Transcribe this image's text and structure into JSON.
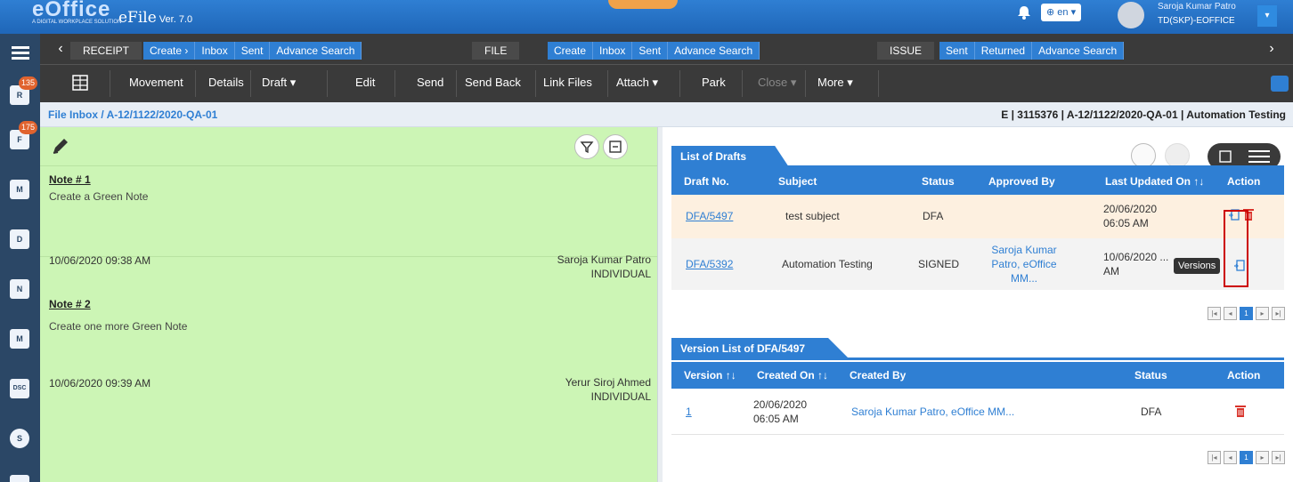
{
  "header": {
    "logo_text": "eOffice",
    "logo_tagline": "A DIGITAL WORKPLACE SOLUTION",
    "app_name": "eFile",
    "version": "Ver. 7.0",
    "language": "en",
    "user_name": "Saroja Kumar Patro",
    "user_org": "TD(SKP)-EOFFICE"
  },
  "sidebar": {
    "items": [
      {
        "name": "receipt",
        "glyph": "R",
        "badge": "135"
      },
      {
        "name": "file",
        "glyph": "F",
        "badge": "175"
      },
      {
        "name": "mail",
        "glyph": "M",
        "badge": ""
      },
      {
        "name": "dashboard",
        "glyph": "D",
        "badge": ""
      },
      {
        "name": "notification",
        "glyph": "N",
        "badge": ""
      },
      {
        "name": "movement",
        "glyph": "M",
        "badge": ""
      },
      {
        "name": "dsc",
        "glyph": "DSC",
        "badge": ""
      },
      {
        "name": "settings",
        "glyph": "S",
        "badge": ""
      },
      {
        "name": "more",
        "glyph": "",
        "badge": ""
      }
    ]
  },
  "nav": {
    "receipt": {
      "label": "RECEIPT",
      "tabs": [
        "Create ›",
        "Inbox",
        "Sent",
        "Advance Search"
      ]
    },
    "file": {
      "label": "FILE",
      "tabs": [
        "Create",
        "Inbox",
        "Sent",
        "Advance Search"
      ]
    },
    "issue": {
      "label": "ISSUE",
      "tabs": [
        "Sent",
        "Returned",
        "Advance Search"
      ]
    }
  },
  "toolbar": {
    "buttons": [
      "Movement",
      "Details",
      "Draft ▾",
      "Edit",
      "Send",
      "Send Back",
      "Link Files",
      "Attach ▾",
      "Park",
      "Close ▾",
      "More ▾"
    ]
  },
  "breadcrumb": {
    "root": "File Inbox",
    "sep": "/",
    "current": "A-12/1122/2020-QA-01",
    "info": "E | 3115376 | A-12/1122/2020-QA-01 | Automation Testing"
  },
  "notes": [
    {
      "title": "Note # 1",
      "body": "Create a Green Note",
      "date": "10/06/2020 09:38 AM",
      "author": "Saroja Kumar Patro",
      "role": "INDIVIDUAL"
    },
    {
      "title": "Note # 2",
      "body": "Create one more Green Note",
      "date": "10/06/2020 09:39 AM",
      "author": "Yerur Siroj Ahmed",
      "role": "INDIVIDUAL"
    }
  ],
  "drafts": {
    "title": "List of Drafts",
    "headers": [
      "Draft No.",
      "Subject",
      "Status",
      "Approved By",
      "Last Updated On ↑↓",
      "Action"
    ],
    "rows": [
      {
        "no": "DFA/5497",
        "subject": "test subject",
        "status": "DFA",
        "approved_by": "",
        "updated": "20/06/2020 06:05 AM"
      },
      {
        "no": "DFA/5392",
        "subject": "Automation Testing",
        "status": "SIGNED",
        "approved_by": "Saroja Kumar Patro, eOffice MM...",
        "updated": "10/06/2020 ... AM"
      }
    ],
    "tooltip": "Versions",
    "page": "1"
  },
  "versions": {
    "title": "Version List of DFA/5497",
    "headers": [
      "Version ↑↓",
      "Created On ↑↓",
      "Created By",
      "Status",
      "Action"
    ],
    "rows": [
      {
        "version": "1",
        "created_on": "20/06/2020 06:05 AM",
        "created_by": "Saroja Kumar Patro, eOffice MM...",
        "status": "DFA"
      }
    ],
    "page": "1"
  },
  "colors": {
    "accent": "#2f7fd3",
    "note_bg": "#ccf5b5",
    "highlight_row": "#fdf0e0",
    "delete": "#d9342b"
  }
}
